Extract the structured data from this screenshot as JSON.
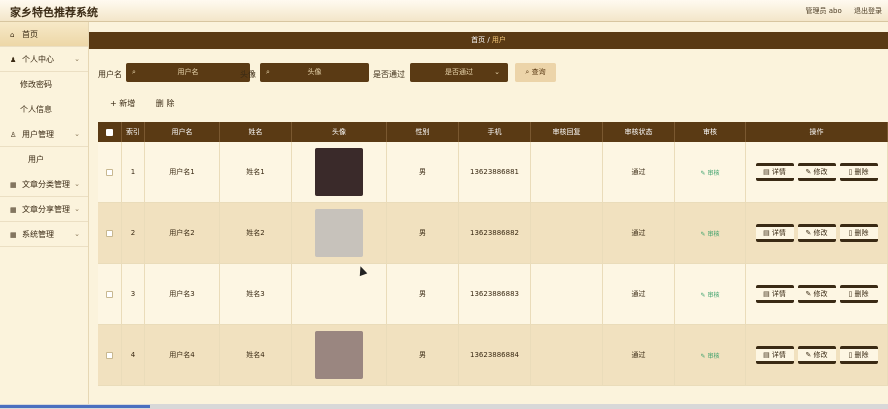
{
  "header": {
    "title": "家乡特色推荐系统",
    "user_info": "管理员 abo",
    "logout": "退出登录"
  },
  "sidebar": {
    "items": [
      {
        "label": "首页",
        "icon": "home-icon"
      },
      {
        "label": "个人中心",
        "icon": "user-icon"
      },
      {
        "label": "修改密码",
        "sub": true
      },
      {
        "label": "个人信息",
        "sub": true
      },
      {
        "label": "用户管理",
        "icon": "users-icon"
      },
      {
        "label": "用户",
        "sub": true
      },
      {
        "label": "文章分类管理",
        "icon": "grid-icon"
      },
      {
        "label": "文章分享管理",
        "icon": "grid-icon"
      },
      {
        "label": "系统管理",
        "icon": "grid-icon"
      }
    ]
  },
  "breadcrumb": {
    "home": "首页",
    "sep": "/",
    "current": "用户"
  },
  "search": {
    "username_label": "用户名",
    "username_placeholder": "用户名",
    "avatar_label": "头像",
    "avatar_placeholder": "头像",
    "approved_label": "是否通过",
    "approved_placeholder": "是否通过",
    "query_btn": "查询"
  },
  "toolbar": {
    "add": "+ 新增",
    "delete": "删 除"
  },
  "table": {
    "headers": [
      "索引",
      "用户名",
      "姓名",
      "头像",
      "性别",
      "手机",
      "审核回复",
      "审核状态",
      "审核",
      "操作"
    ],
    "rows": [
      {
        "index": "1",
        "username": "用户名1",
        "name": "姓名1",
        "gender": "男",
        "phone": "13623886881",
        "reply": "",
        "status": "通过",
        "audit": "审核",
        "has_avatar": true,
        "avatar_color": "#3a2a2a"
      },
      {
        "index": "2",
        "username": "用户名2",
        "name": "姓名2",
        "gender": "男",
        "phone": "13623886882",
        "reply": "",
        "status": "通过",
        "audit": "审核",
        "has_avatar": true,
        "avatar_color": "#c7c2bb"
      },
      {
        "index": "3",
        "username": "用户名3",
        "name": "姓名3",
        "gender": "男",
        "phone": "13623886883",
        "reply": "",
        "status": "通过",
        "audit": "审核",
        "has_avatar": false
      },
      {
        "index": "4",
        "username": "用户名4",
        "name": "姓名4",
        "gender": "男",
        "phone": "13623886884",
        "reply": "",
        "status": "通过",
        "audit": "审核",
        "has_avatar": true,
        "avatar_color": "#9a8680"
      }
    ],
    "ops": {
      "detail": "详情",
      "edit": "修改",
      "del": "删除"
    }
  },
  "colors": {
    "brand": "#5a3a14",
    "accent": "#f5c978",
    "bg": "#fbf3dc"
  }
}
